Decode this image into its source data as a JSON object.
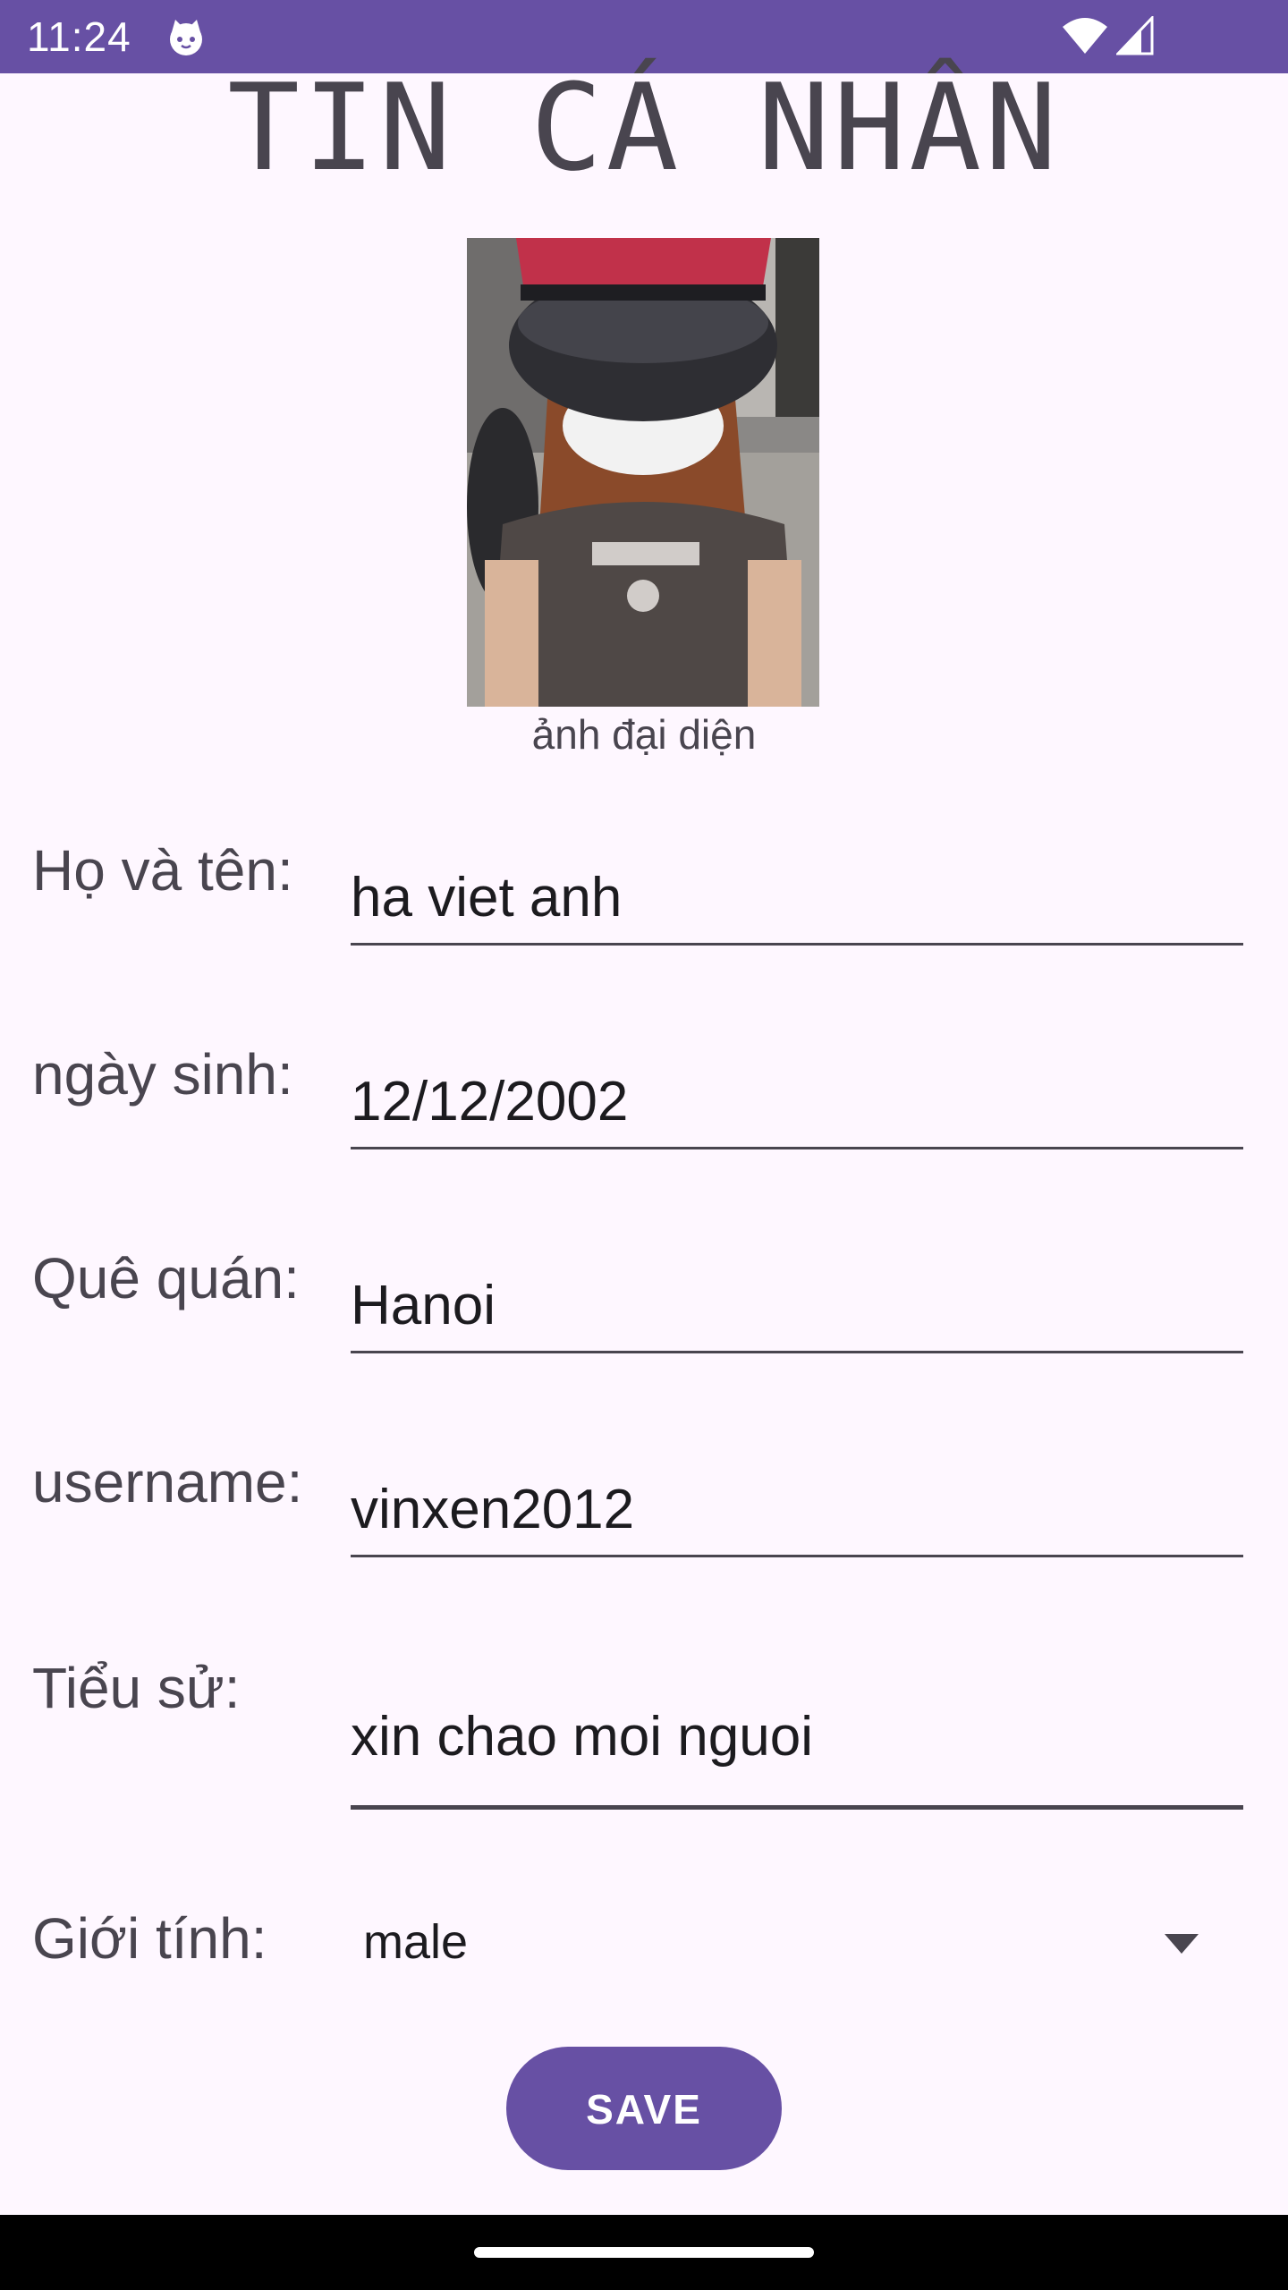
{
  "status_bar": {
    "time": "11:24",
    "app_icon": "cat-face-icon",
    "wifi_icon": "wifi-icon",
    "signal_icon": "cell-signal-icon",
    "background": "#6750a4"
  },
  "page": {
    "title": "TIN CÁ NHÂN"
  },
  "avatar": {
    "caption": "ảnh đại diện"
  },
  "form": {
    "fields": [
      {
        "label": "Họ và tên:",
        "value": "ha viet  anh"
      },
      {
        "label": "ngày sinh:",
        "value": "12/12/2002"
      },
      {
        "label": "Quê quán:",
        "value": "Hanoi"
      },
      {
        "label": "username:",
        "value": "vinxen2012"
      },
      {
        "label": "Tiểu sử:",
        "value": "xin chao moi nguoi"
      }
    ],
    "gender": {
      "label": "Giới tính:",
      "selected": "male",
      "icon": "dropdown-arrow-icon"
    },
    "save_label": "SAVE"
  },
  "colors": {
    "accent": "#6750a4",
    "text": "#49454f",
    "background": "#fef7ff"
  }
}
